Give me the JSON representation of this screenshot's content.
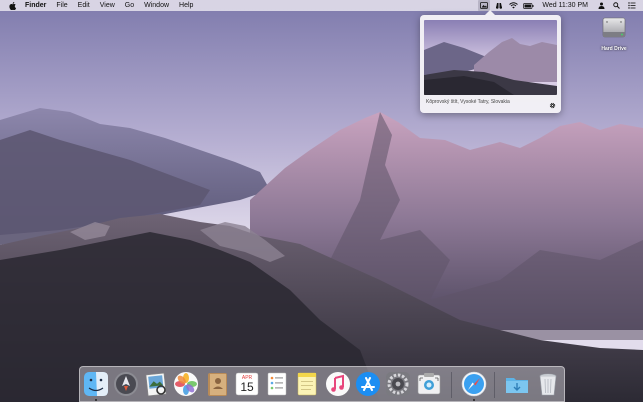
{
  "menubar": {
    "apple_icon": "apple-logo-icon",
    "app_name": "Finder",
    "menus": [
      "File",
      "Edit",
      "View",
      "Go",
      "Window",
      "Help"
    ],
    "status_icons": [
      "wallpaper-app-icon",
      "binoculars-icon",
      "wifi-icon",
      "battery-icon"
    ],
    "clock": "Wed 11:30 PM",
    "extra_icons": [
      "user-icon",
      "spotlight-icon",
      "notification-center-icon"
    ]
  },
  "popover": {
    "caption": "Kôprovský štít, Vysoké Tatry, Slovakia",
    "settings_icon": "gear-icon"
  },
  "desktop": {
    "icons": [
      {
        "label": "Hard Drive",
        "icon": "hard-drive-icon"
      }
    ]
  },
  "dock": {
    "apps": [
      {
        "name": "Finder",
        "icon": "finder-icon",
        "running": true
      },
      {
        "name": "Launchpad",
        "icon": "launchpad-icon",
        "running": false
      },
      {
        "name": "Preview",
        "icon": "preview-icon",
        "running": false
      },
      {
        "name": "Photos",
        "icon": "photos-icon",
        "running": false
      },
      {
        "name": "Contacts",
        "icon": "contacts-icon",
        "running": false
      },
      {
        "name": "Calendar",
        "icon": "calendar-icon",
        "running": false,
        "month": "APR",
        "day": "15"
      },
      {
        "name": "Reminders",
        "icon": "reminders-icon",
        "running": false
      },
      {
        "name": "Notes",
        "icon": "notes-icon",
        "running": false
      },
      {
        "name": "Music",
        "icon": "music-icon",
        "running": false
      },
      {
        "name": "App Store",
        "icon": "app-store-icon",
        "running": false
      },
      {
        "name": "System Preferences",
        "icon": "system-preferences-icon",
        "running": false
      },
      {
        "name": "Screenshot",
        "icon": "screenshot-icon",
        "running": false
      },
      {
        "name": "Safari",
        "icon": "safari-icon",
        "running": true
      },
      {
        "name": "Downloads",
        "icon": "downloads-folder-icon",
        "running": false
      },
      {
        "name": "Trash",
        "icon": "trash-icon",
        "running": false
      }
    ]
  },
  "colors": {
    "sky_top": "#8c86b8",
    "sky_bottom": "#ddd7ea",
    "mountain_dark": "#3a3848",
    "peak_pink": "#c49ab8",
    "menubar_bg": "#ece8f0"
  }
}
